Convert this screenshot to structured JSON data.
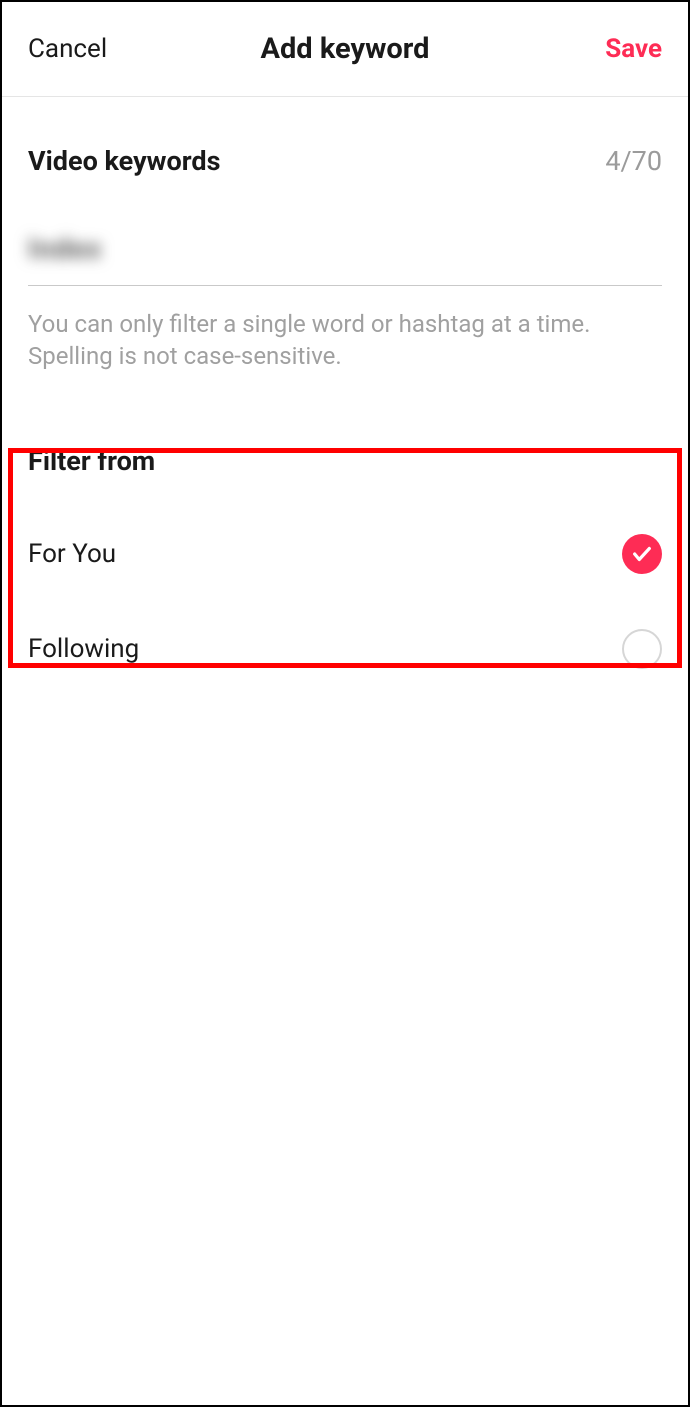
{
  "header": {
    "cancel": "Cancel",
    "title": "Add keyword",
    "save": "Save"
  },
  "keywords": {
    "section_title": "Video keywords",
    "counter": "4/70",
    "input_value": "Index",
    "helper": "You can only filter a single word or hashtag at a time. Spelling is not case-sensitive."
  },
  "filter": {
    "title": "Filter from",
    "options": [
      {
        "label": "For You",
        "selected": true
      },
      {
        "label": "Following",
        "selected": false
      }
    ]
  },
  "colors": {
    "accent": "#fe2c55",
    "highlight": "#ff0000"
  }
}
